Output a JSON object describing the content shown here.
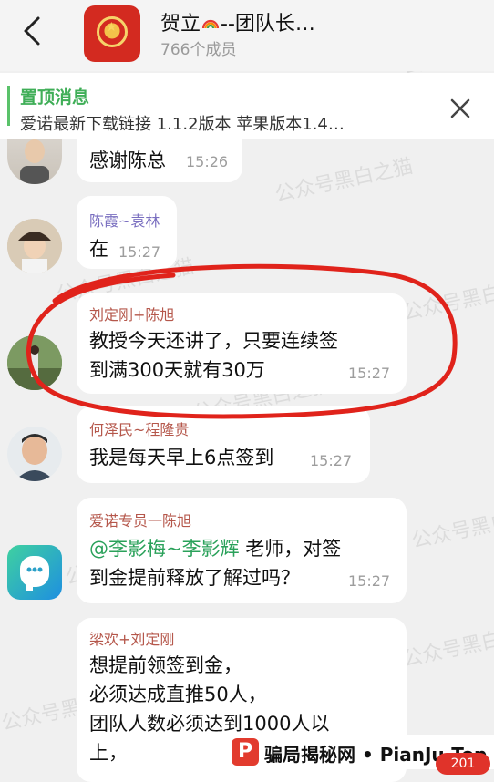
{
  "header": {
    "title_prefix": "贺立",
    "title_suffix": "--团队长…",
    "members": "766个成员"
  },
  "pinned": {
    "title": "置顶消息",
    "text": "爱诺最新下载链接  1.1.2版本     苹果版本1.4…"
  },
  "messages": [
    {
      "sender": "",
      "text": "感谢陈总",
      "time": "15:26"
    },
    {
      "sender": "陈霞~袁林",
      "sender_color": "#7a6fc0",
      "text": "在",
      "time": "15:27"
    },
    {
      "sender": "刘定刚+陈旭",
      "sender_color": "#b5574b",
      "text_line1": "教授今天还讲了，只要连续签",
      "text_line2": "到满300天就有30万",
      "time": "15:27"
    },
    {
      "sender": "何泽民~程隆贵",
      "sender_color": "#b5574b",
      "text": "我是每天早上6点签到",
      "time": "15:27"
    },
    {
      "sender": "爱诺专员一陈旭",
      "sender_color": "#b5574b",
      "mention": "@李影梅~李影辉",
      "text_line1": " 老师，对签",
      "text_line2": "到金提前释放了解过吗？",
      "time": "15:27"
    },
    {
      "sender": "梁欢+刘定刚",
      "sender_color": "#b5574b",
      "text_line1": "想提前领签到金，",
      "text_line2": "必须达成直推50人，",
      "text_line3": "团队人数必须达到1000人以",
      "text_line4": "上，"
    }
  ],
  "watermark": "公众号黑白之猫",
  "site_banner": {
    "text": "骗局揭秘网 • PianJu.Top"
  },
  "unread_badge": "201",
  "colors": {
    "accent_green": "#3fae57",
    "annotation_red": "#e0231b",
    "background": "#f0f0f0"
  }
}
